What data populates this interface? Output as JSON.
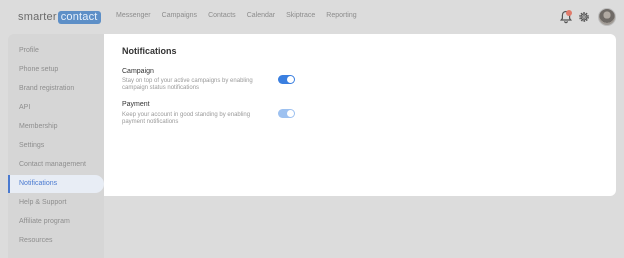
{
  "logo": {
    "part1": "smarter",
    "part2": "contact"
  },
  "nav": {
    "items": [
      "Messenger",
      "Campaigns",
      "Contacts",
      "Calendar",
      "Skiptrace",
      "Reporting"
    ]
  },
  "sidebar": {
    "items": [
      {
        "label": "Profile"
      },
      {
        "label": "Phone setup"
      },
      {
        "label": "Brand registration"
      },
      {
        "label": "API"
      },
      {
        "label": "Membership"
      },
      {
        "label": "Settings"
      },
      {
        "label": "Contact management"
      },
      {
        "label": "Notifications",
        "active": true
      },
      {
        "label": "Help & Support"
      },
      {
        "label": "Affiliate program"
      },
      {
        "label": "Resources"
      }
    ]
  },
  "panel": {
    "title": "Notifications",
    "settings": [
      {
        "title": "Campaign",
        "description": "Stay on top of your active campaigns by enabling campaign status notifications",
        "enabled": true
      },
      {
        "title": "Payment",
        "description": "Keep your account in good standing by enabling payment notifications",
        "enabled": true,
        "disabled": true
      }
    ]
  },
  "icons": {
    "bell": "bell-icon",
    "gear": "gear-icon",
    "avatar": "avatar"
  },
  "colors": {
    "accent": "#3a7fe0",
    "badge": "#e07a6a",
    "logo_bg": "#5d8fc7"
  }
}
